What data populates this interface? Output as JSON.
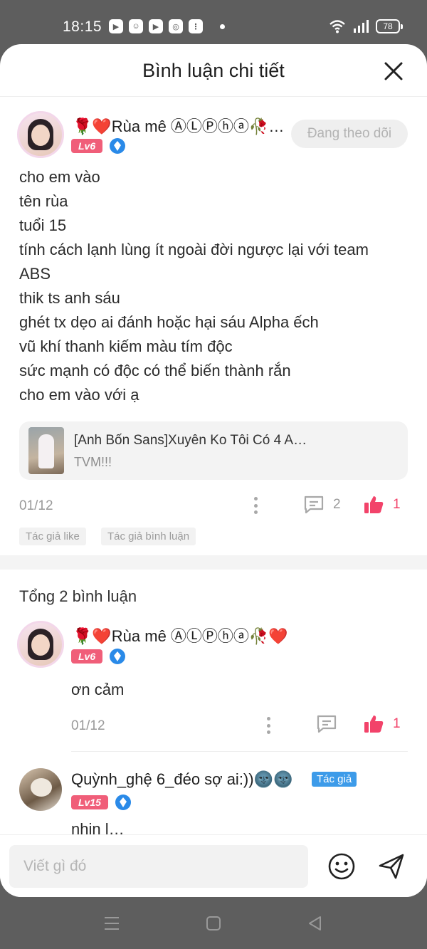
{
  "status_bar": {
    "time": "18:15",
    "battery": "78"
  },
  "header": {
    "title": "Bình luận chi tiết"
  },
  "main_comment": {
    "user_name": "🌹❤️Rùa mê ⒶⓁⓅⓗⓐ🥀…",
    "level": "Lv6",
    "follow_label": "Đang theo dõi",
    "lines": [
      "cho em vào",
      "tên rùa",
      "tuổi 15",
      "tính cách lạnh lùng ít ngoài đời ngược lại với team",
      "ABS",
      "thik ts anh sáu",
      "ghét tx dẹo ai đánh hoặc hại sáu Alpha ếch",
      "vũ khí thanh kiếm màu tím độc",
      "sức mạnh có độc có thể biến thành rắn",
      "cho em vào với ạ"
    ],
    "story": {
      "title": "[Anh Bốn Sans]Xuyên Ko Tôi Có 4 A…",
      "subtitle": "TVM!!!"
    },
    "date": "01/12",
    "reply_count": "2",
    "like_count": "1",
    "tags": [
      "Tác giả like",
      "Tác giả bình luận"
    ]
  },
  "total_label": "Tổng 2 bình luận",
  "replies": [
    {
      "user_name": "🌹❤️Rùa mê ⒶⓁⓅⓗⓐ🥀❤️",
      "level": "Lv6",
      "text": "ơn cảm",
      "date": "01/12",
      "like_count": "1"
    },
    {
      "user_name": "Quỳnh_ghệ 6_đéo sợ ai:))🌚🌚",
      "level": "Lv15",
      "author_tag": "Tác giả",
      "partial_text": "nhin l…"
    }
  ],
  "input": {
    "placeholder": "Viết gì đó"
  },
  "icons": {
    "close": "close-icon",
    "comment": "comment-icon",
    "like": "thumbs-up-icon",
    "emoji": "smiley-icon",
    "send": "send-icon",
    "diamond": "diamond-icon"
  },
  "colors": {
    "accent_red": "#f2436a",
    "level_badge": "#f05e79",
    "author_tag": "#3d9be9",
    "diamond": "#2a8ae8"
  }
}
